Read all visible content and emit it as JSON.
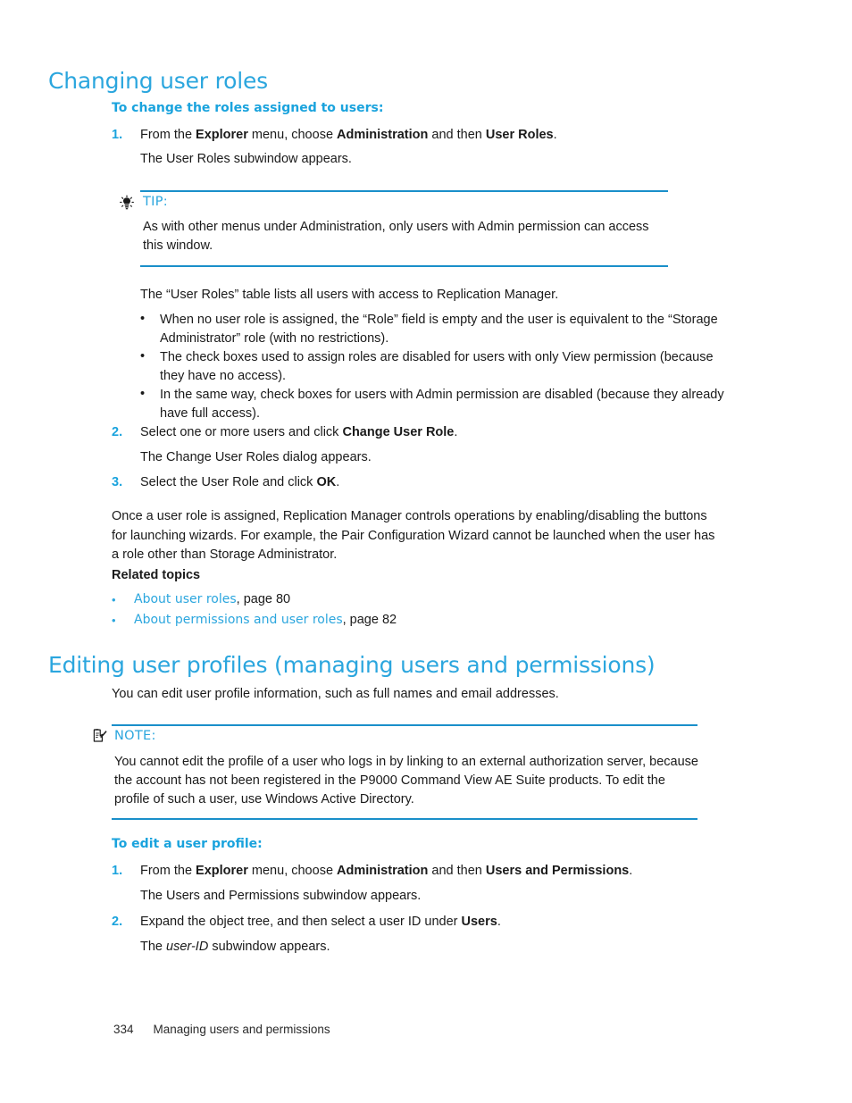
{
  "colors": {
    "heading_blue": "#2ba6de",
    "subheading_blue": "#1aa3dd",
    "rule_blue": "#1a8fca",
    "body_black": "#1a1a1a",
    "link_blue": "#2ba6de"
  },
  "section_user_roles": {
    "heading": "Changing user roles",
    "task_heading": "To change the roles assigned to users:",
    "steps": [
      {
        "number": "1.",
        "segments": [
          {
            "text": "From the ",
            "style": "normal"
          },
          {
            "text": "Explorer",
            "style": "bold"
          },
          {
            "text": " menu, choose ",
            "style": "normal"
          },
          {
            "text": "Administration",
            "style": "bold"
          },
          {
            "text": " and then ",
            "style": "normal"
          },
          {
            "text": "User Roles",
            "style": "bold"
          },
          {
            "text": ".",
            "style": "normal"
          }
        ],
        "result": "The User Roles subwindow appears."
      },
      {
        "number": "2.",
        "segments": [
          {
            "text": "Select one or more users and click ",
            "style": "normal"
          },
          {
            "text": "Change User Role",
            "style": "bold"
          },
          {
            "text": ".",
            "style": "normal"
          }
        ],
        "result": "The Change User Roles dialog appears."
      },
      {
        "number": "3.",
        "segments": [
          {
            "text": "Select the User Role and click ",
            "style": "normal"
          },
          {
            "text": "OK",
            "style": "bold"
          },
          {
            "text": ".",
            "style": "normal"
          }
        ],
        "result": ""
      }
    ],
    "tip": {
      "icon": "lightbulb-icon",
      "label": "TIP:",
      "body": "As with other menus under Administration, only users with Admin permission can access this window."
    },
    "table_intro": "The “User Roles” table lists all users with access to Replication Manager.",
    "bullets": [
      "When no user role is assigned, the “Role” field is empty and the user is equivalent to the “Storage Administrator” role (with no restrictions).",
      "The check boxes used to assign roles are disabled for users with only View permission (because they have no access).",
      "In the same way, check boxes for users with Admin permission are disabled (because they already have full access)."
    ],
    "closing_paragraph": "Once a user role is assigned, Replication Manager controls operations by enabling/disabling the buttons for launching wizards. For example, the Pair Configuration Wizard cannot be launched when the user has a role other than Storage Administrator.",
    "related_topics_heading": "Related topics",
    "related_topics": [
      {
        "link_text": "About user roles",
        "suffix": ", page 80"
      },
      {
        "link_text": "About permissions and user roles",
        "suffix": ", page 82"
      }
    ]
  },
  "section_user_profiles": {
    "heading": "Editing user profiles (managing users and permissions)",
    "intro": "You can edit user profile information, such as full names and email addresses.",
    "note": {
      "icon": "note-pad-icon",
      "label": "NOTE:",
      "body": "You cannot edit the profile of a user who logs in by linking to an external authorization server, because the account has not been registered in the P9000 Command View AE Suite products. To edit the profile of such a user, use Windows Active Directory."
    },
    "task_heading": "To edit a user profile:",
    "steps": [
      {
        "number": "1.",
        "segments": [
          {
            "text": "From the ",
            "style": "normal"
          },
          {
            "text": "Explorer",
            "style": "bold"
          },
          {
            "text": " menu, choose ",
            "style": "normal"
          },
          {
            "text": "Administration",
            "style": "bold"
          },
          {
            "text": " and then ",
            "style": "normal"
          },
          {
            "text": "Users and Permissions",
            "style": "bold"
          },
          {
            "text": ".",
            "style": "normal"
          }
        ],
        "result": "The Users and Permissions subwindow appears."
      },
      {
        "number": "2.",
        "segments": [
          {
            "text": "Expand the object tree, and then select a user ID under ",
            "style": "normal"
          },
          {
            "text": "Users",
            "style": "bold"
          },
          {
            "text": ".",
            "style": "normal"
          }
        ],
        "result_segments": [
          {
            "text": "The ",
            "style": "normal"
          },
          {
            "text": "user-ID",
            "style": "italic"
          },
          {
            "text": " subwindow appears.",
            "style": "normal"
          }
        ]
      }
    ]
  },
  "footer": {
    "page_number": "334",
    "running_title": "Managing users and permissions"
  },
  "bullet_glyph": "•"
}
